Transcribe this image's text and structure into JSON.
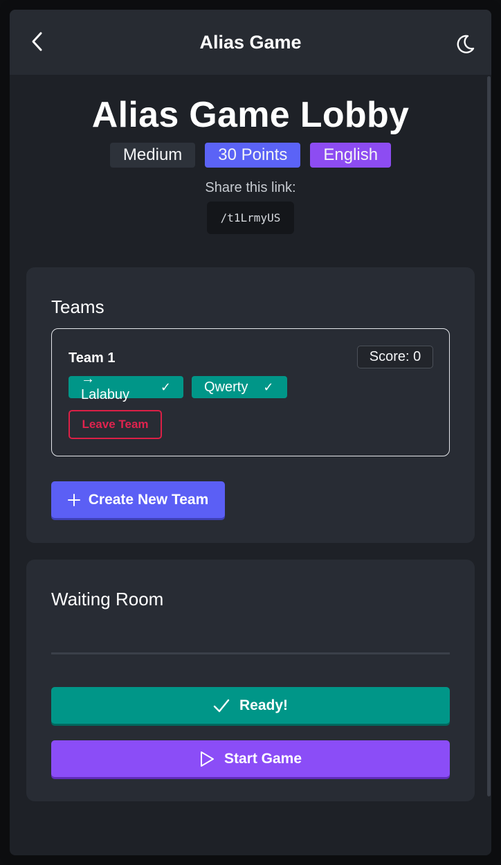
{
  "header": {
    "title": "Alias Game",
    "back_icon": "chevron-left-icon",
    "theme_icon": "moon-icon"
  },
  "lobby": {
    "title": "Alias Game Lobby",
    "badges": {
      "difficulty": "Medium",
      "points": "30 Points",
      "language": "English"
    },
    "share_label": "Share this link:",
    "share_link": "/t1LrmyUS"
  },
  "teams_section": {
    "title": "Teams",
    "teams": [
      {
        "name": "Team 1",
        "score": "Score: 0",
        "members": [
          {
            "name": "→ Lalabuy",
            "ready_mark": "✓"
          },
          {
            "name": "Qwerty",
            "ready_mark": "✓"
          }
        ],
        "leave_label": "Leave Team"
      }
    ],
    "create_team_label": "Create New Team"
  },
  "waiting_room": {
    "title": "Waiting Room",
    "ready_label": "Ready!",
    "start_label": "Start Game"
  },
  "colors": {
    "background": "#1e2127",
    "card": "#282c34",
    "teal": "#009688",
    "indigo": "#5b5ff5",
    "purple": "#8b4df7",
    "danger": "#dc2046"
  }
}
